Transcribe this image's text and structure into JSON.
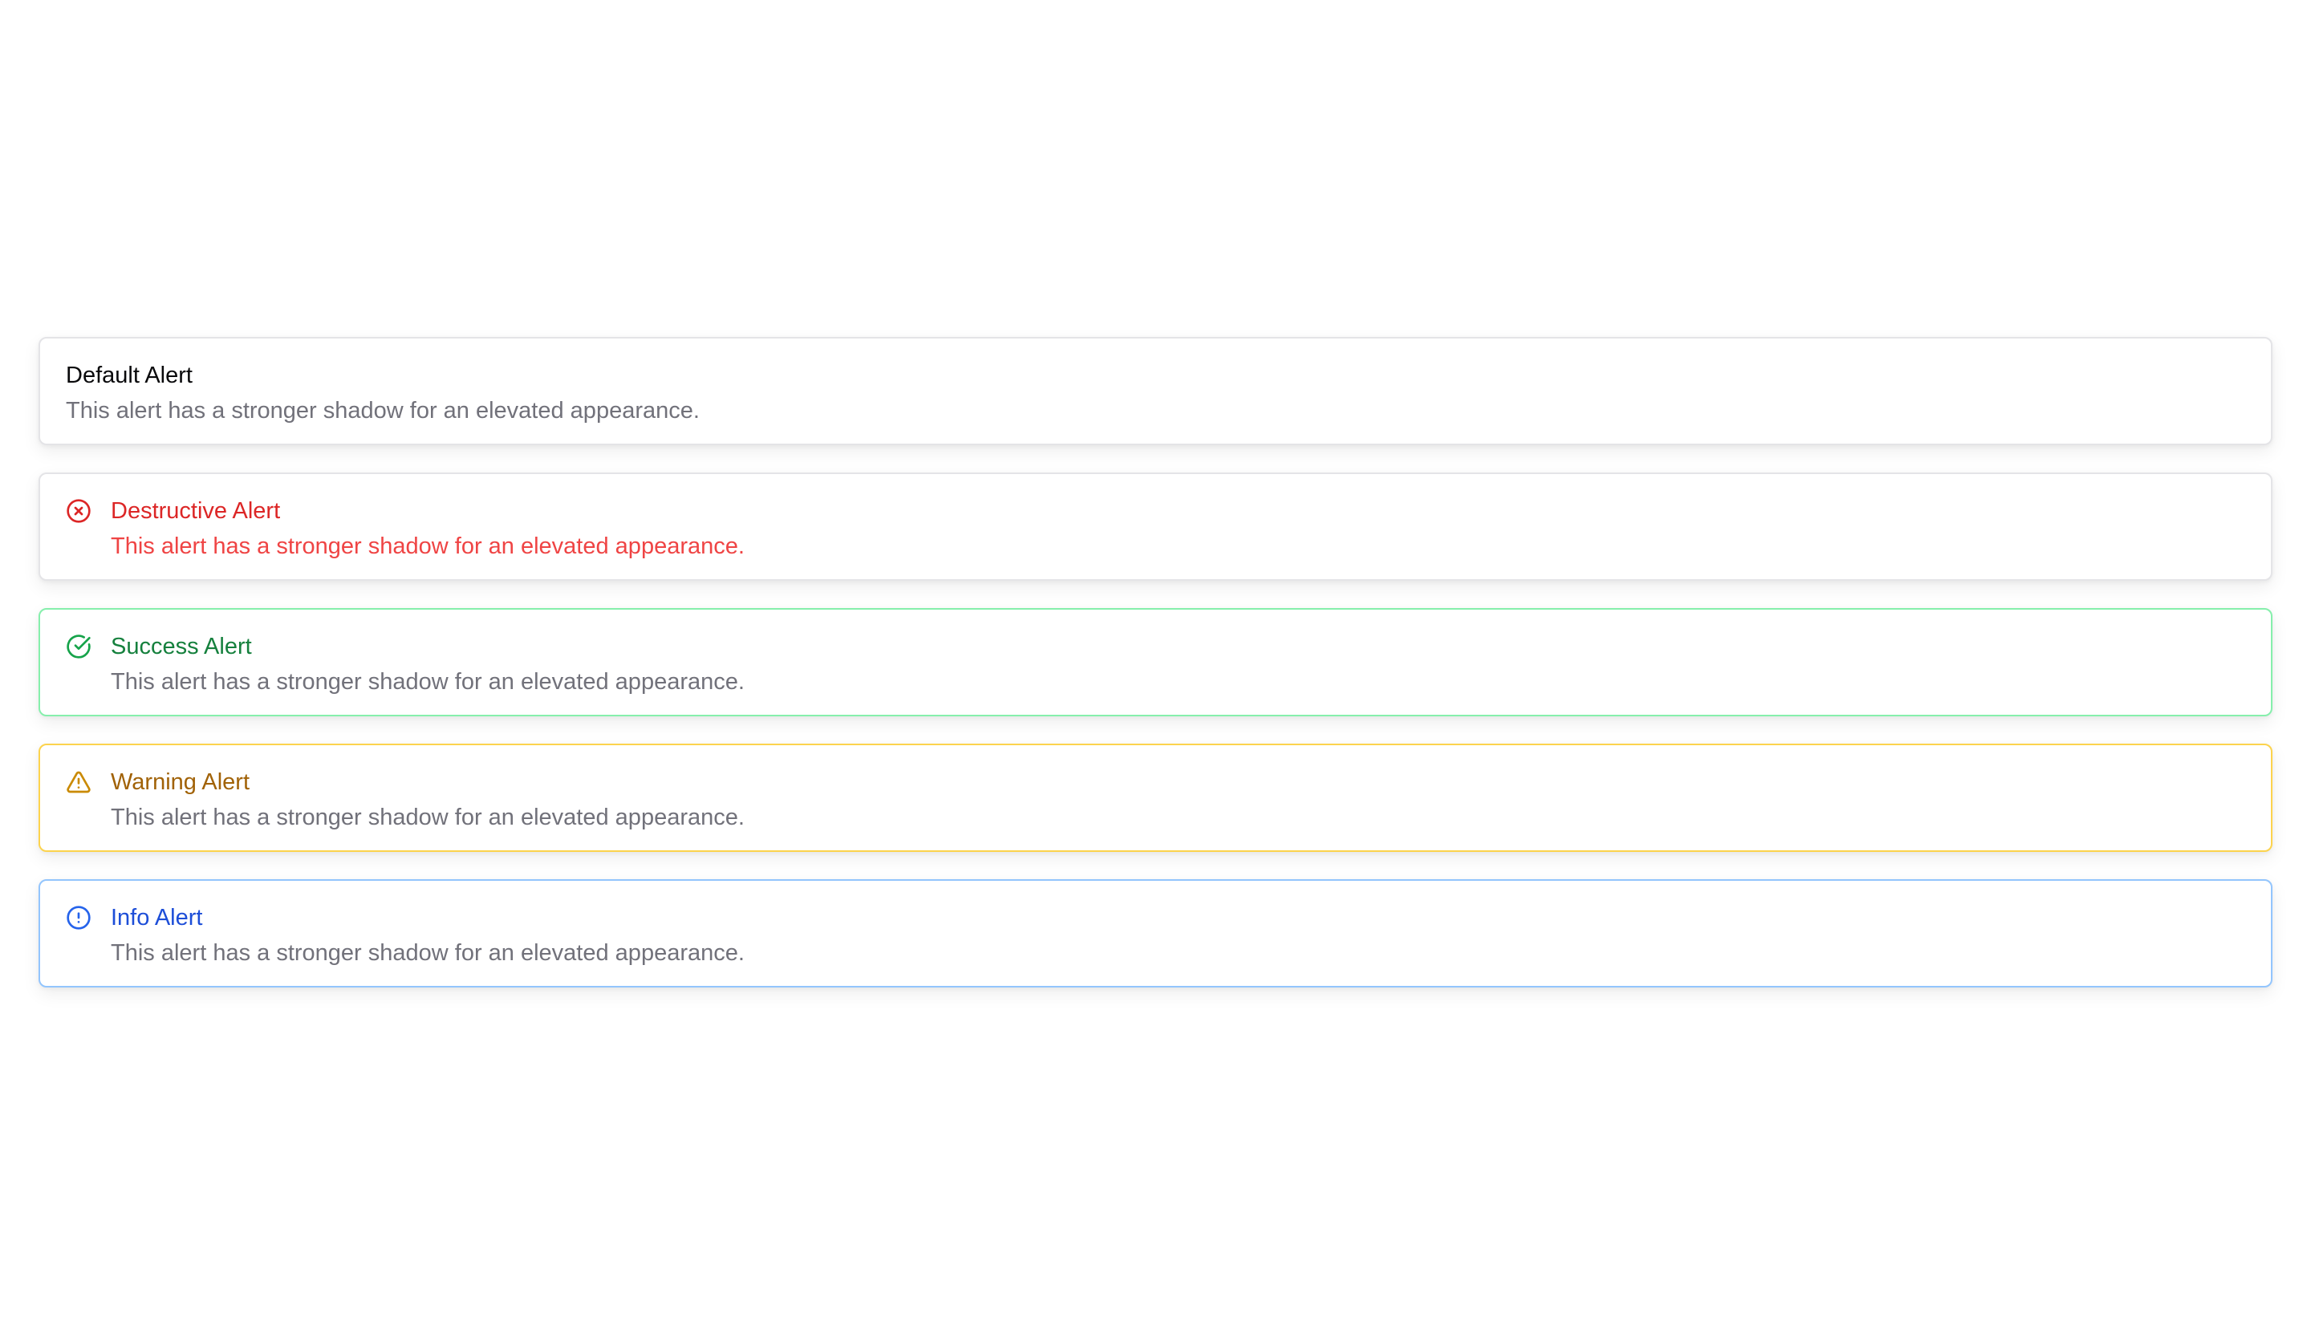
{
  "alerts": [
    {
      "variant": "default",
      "title": "Default Alert",
      "description": "This alert has a stronger shadow for an elevated appearance.",
      "icon": null
    },
    {
      "variant": "destructive",
      "title": "Destructive Alert",
      "description": "This alert has a stronger shadow for an elevated appearance.",
      "icon": "x-circle-icon",
      "color": "#dc2626"
    },
    {
      "variant": "success",
      "title": "Success Alert",
      "description": "This alert has a stronger shadow for an elevated appearance.",
      "icon": "check-circle-icon",
      "color": "#16a34a"
    },
    {
      "variant": "warning",
      "title": "Warning Alert",
      "description": "This alert has a stronger shadow for an elevated appearance.",
      "icon": "alert-triangle-icon",
      "color": "#ca8a04"
    },
    {
      "variant": "info",
      "title": "Info Alert",
      "description": "This alert has a stronger shadow for an elevated appearance.",
      "icon": "info-circle-icon",
      "color": "#2563eb"
    }
  ]
}
